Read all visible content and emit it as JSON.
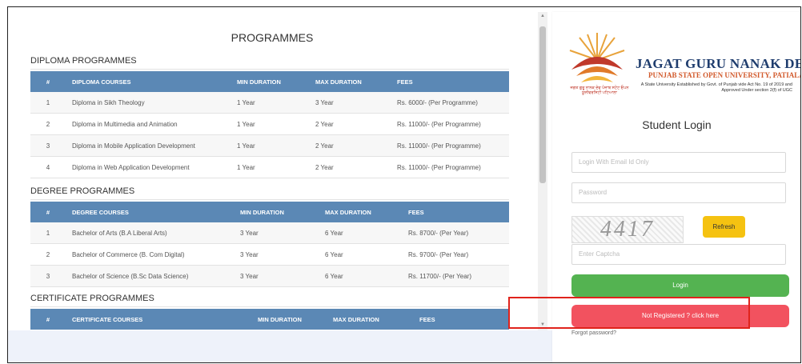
{
  "programmes": {
    "title": "PROGRAMMES",
    "diploma": {
      "heading": "DIPLOMA PROGRAMMES",
      "columns": [
        "#",
        "DIPLOMA COURSES",
        "MIN DURATION",
        "MAX DURATION",
        "FEES"
      ],
      "rows": [
        [
          "1",
          "Diploma in Sikh Theology",
          "1 Year",
          "3 Year",
          "Rs. 6000/- (Per Programme)"
        ],
        [
          "2",
          "Diploma in Multimedia and Animation",
          "1 Year",
          "2 Year",
          "Rs. 11000/- (Per Programme)"
        ],
        [
          "3",
          "Diploma in Mobile Application Development",
          "1 Year",
          "2 Year",
          "Rs. 11000/- (Per Programme)"
        ],
        [
          "4",
          "Diploma in Web Application Development",
          "1 Year",
          "2 Year",
          "Rs. 11000/- (Per Programme)"
        ]
      ]
    },
    "degree": {
      "heading": "DEGREE PROGRAMMES",
      "columns": [
        "#",
        "DEGREE COURSES",
        "MIN DURATION",
        "MAX DURATION",
        "FEES"
      ],
      "rows": [
        [
          "1",
          "Bachelor of Arts (B.A Liberal Arts)",
          "3 Year",
          "6 Year",
          "Rs. 8700/- (Per Year)"
        ],
        [
          "2",
          "Bachelor of Commerce (B. Com Digital)",
          "3 Year",
          "6 Year",
          "Rs. 9700/- (Per Year)"
        ],
        [
          "3",
          "Bachelor of Science (B.Sc Data Science)",
          "3 Year",
          "6 Year",
          "Rs. 11700/- (Per Year)"
        ]
      ]
    },
    "certificate": {
      "heading": "CERTIFICATE PROGRAMMES",
      "columns": [
        "#",
        "CERTIFICATE COURSES",
        "MIN DURATION",
        "MAX DURATION",
        "FEES"
      ]
    }
  },
  "university": {
    "name": "JAGAT GURU NANAK DEV",
    "subtitle": "PUNJAB STATE OPEN UNIVERSITY, PATIALA",
    "note": "A State University Established by Govt. of Punjab vide Act No. 19 of 2019 and Approved Under section 2(f) of UGC",
    "tagline": "ਜਗਤ ਗੁਰੂ ਨਾਨਕ ਦੇਵ ਪੰਜਾਬ ਸਟੇਟ ਓਪਨ ਯੂਨੀਵਰਸਿਟੀ ਪਟਿਆਲਾ"
  },
  "login": {
    "title": "Student Login",
    "email_placeholder": "Login With Email Id Only",
    "password_placeholder": "Password",
    "captcha_text": "4417",
    "refresh_label": "Refresh",
    "captcha_placeholder": "Enter Captcha",
    "login_label": "Login",
    "register_label": "Not Registered ? click here",
    "forgot_label": "Forgot password?"
  },
  "colors": {
    "table_header": "#5b88b5",
    "login_button": "#54b351",
    "register_button": "#f2525f",
    "refresh_button": "#f5c211",
    "highlight_border": "#e0231c",
    "university_name": "#1f3d6e",
    "university_subtitle": "#d25a2c"
  }
}
